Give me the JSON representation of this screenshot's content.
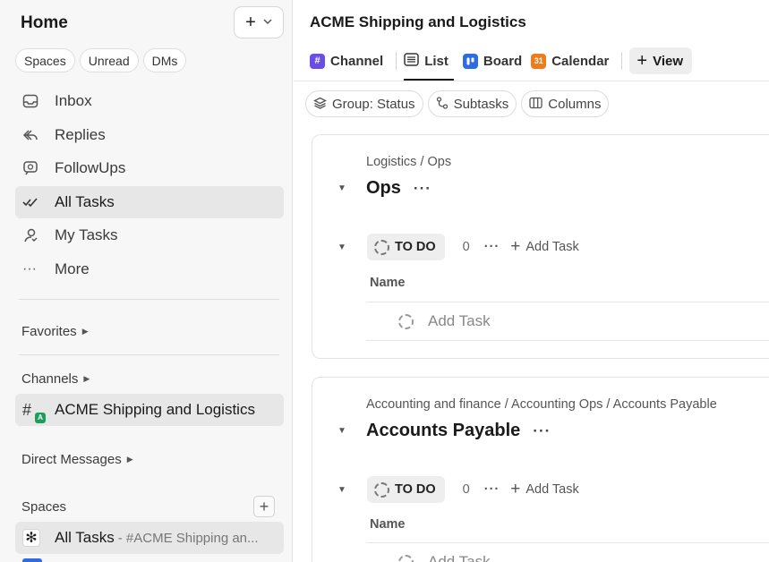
{
  "sidebar": {
    "title": "Home",
    "new_button": {
      "label": "+",
      "chevron": "⌵"
    },
    "pills": [
      "Spaces",
      "Unread",
      "DMs"
    ],
    "nav": [
      {
        "label": "Inbox",
        "icon": "inbox-icon"
      },
      {
        "label": "Replies",
        "icon": "reply-icon"
      },
      {
        "label": "FollowUps",
        "icon": "followup-icon"
      },
      {
        "label": "All Tasks",
        "icon": "double-check-icon",
        "active": true
      },
      {
        "label": "My Tasks",
        "icon": "user-icon"
      },
      {
        "label": "More",
        "icon": "more-icon"
      }
    ],
    "favorites_label": "Favorites",
    "channels_label": "Channels",
    "channel_item": {
      "label": "ACME Shipping and Logistics",
      "badge": "A"
    },
    "direct_messages_label": "Direct Messages",
    "spaces_label": "Spaces",
    "space_item": {
      "label": "All Tasks",
      "suffix": "- #ACME Shipping an..."
    }
  },
  "main": {
    "title": "ACME Shipping and Logistics",
    "tabs": [
      {
        "label": "Channel",
        "icon": "#",
        "color": "#6b4de6"
      },
      {
        "label": "List",
        "icon": "list-icon",
        "selected": true
      },
      {
        "label": "Board",
        "icon": "board-icon",
        "color": "#2f6ce0"
      },
      {
        "label": "Calendar",
        "icon": "31",
        "color": "#f07a1c"
      }
    ],
    "view_button": "View",
    "filters": [
      {
        "label": "Group: Status",
        "icon": "layers-icon"
      },
      {
        "label": "Subtasks",
        "icon": "subtasks-icon"
      },
      {
        "label": "Columns",
        "icon": "columns-icon"
      }
    ],
    "lists": [
      {
        "breadcrumb": "Logistics / Ops",
        "name": "Ops",
        "status": "TO DO",
        "count": "0",
        "add_task": "Add Task",
        "column": "Name",
        "add_row": "Add Task"
      },
      {
        "breadcrumb": "Accounting and finance / Accounting Ops / Accounts Payable",
        "name": "Accounts Payable",
        "status": "TO DO",
        "count": "0",
        "add_task": "Add Task",
        "column": "Name",
        "add_row": "Add Task"
      }
    ]
  }
}
